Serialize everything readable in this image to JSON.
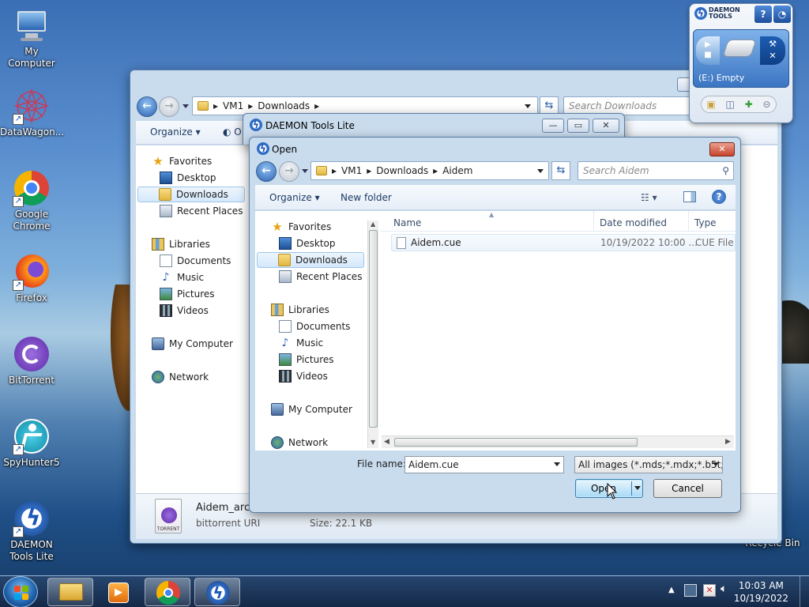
{
  "desktop": {
    "icons": [
      {
        "label": "My Computer"
      },
      {
        "label": "DataWagon..."
      },
      {
        "label": "Google Chrome"
      },
      {
        "label": "Firefox"
      },
      {
        "label": "BitTorrent"
      },
      {
        "label": "SpyHunter5"
      },
      {
        "label": "DAEMON Tools Lite"
      },
      {
        "label": "Recycle Bin"
      }
    ]
  },
  "gadget": {
    "brand": "DAEMON TOOLS",
    "help": "?",
    "drive_label": "(E:) Empty"
  },
  "explorer": {
    "path": [
      "VM1",
      "Downloads"
    ],
    "search_placeholder": "Search Downloads",
    "organize": "Organize",
    "open_partial": "O",
    "nav": {
      "favorites": "Favorites",
      "desktop": "Desktop",
      "downloads": "Downloads",
      "recent": "Recent Places",
      "libraries": "Libraries",
      "documents": "Documents",
      "music": "Music",
      "pictures": "Pictures",
      "videos": "Videos",
      "computer": "My Computer",
      "network": "Network"
    },
    "details": {
      "name": "Aidem_arch",
      "type": "bittorrent URI",
      "size": "Size: 22.1 KB",
      "thumb": "TORRENT"
    }
  },
  "daemon_window": {
    "title": "DAEMON Tools Lite"
  },
  "open_dialog": {
    "title": "Open",
    "path": [
      "VM1",
      "Downloads",
      "Aidem"
    ],
    "search_placeholder": "Search Aidem",
    "organize": "Organize",
    "new_folder": "New folder",
    "help": "?",
    "nav": {
      "favorites": "Favorites",
      "desktop": "Desktop",
      "downloads": "Downloads",
      "recent": "Recent Places",
      "libraries": "Libraries",
      "documents": "Documents",
      "music": "Music",
      "pictures": "Pictures",
      "videos": "Videos",
      "computer": "My Computer",
      "network": "Network"
    },
    "columns": {
      "name": "Name",
      "date": "Date modified",
      "type": "Type"
    },
    "files": [
      {
        "name": "Aidem.cue",
        "date": "10/19/2022 10:00 ...",
        "type": "CUE File"
      }
    ],
    "file_name_label": "File name:",
    "file_name_value": "Aidem.cue",
    "filter": "All images (*.mds;*.mdx;*.b5t;*",
    "open_button": "Open",
    "cancel_button": "Cancel"
  },
  "taskbar": {
    "time": "10:03 AM",
    "date": "10/19/2022"
  }
}
